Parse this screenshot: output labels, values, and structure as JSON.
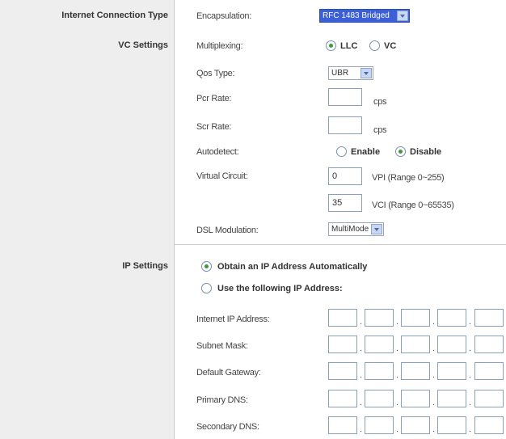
{
  "sections": {
    "internet_connection_type": "Internet Connection Type",
    "vc_settings": "VC Settings",
    "ip_settings": "IP Settings"
  },
  "encapsulation": {
    "label": "Encapsulation:",
    "value": "RFC 1483 Bridged"
  },
  "multiplexing": {
    "label": "Multiplexing:",
    "options": [
      "LLC",
      "VC"
    ],
    "selected": "LLC"
  },
  "qos_type": {
    "label": "Qos Type:",
    "value": "UBR"
  },
  "pcr_rate": {
    "label": "Pcr Rate:",
    "value": "",
    "unit": "cps"
  },
  "scr_rate": {
    "label": "Scr Rate:",
    "value": "",
    "unit": "cps"
  },
  "autodetect": {
    "label": "Autodetect:",
    "options": [
      "Enable",
      "Disable"
    ],
    "selected": "Disable"
  },
  "virtual_circuit": {
    "label": "Virtual Circuit:",
    "vpi_value": "0",
    "vpi_hint": "VPI (Range 0~255)",
    "vci_value": "35",
    "vci_hint": "VCI (Range 0~65535)"
  },
  "dsl_modulation": {
    "label": "DSL Modulation:",
    "value": "MultiMode"
  },
  "ip_mode": {
    "obtain_auto": "Obtain an IP Address Automatically",
    "use_following": "Use the following IP Address:",
    "selected": "obtain_auto"
  },
  "ip_fields": [
    {
      "label": "Internet IP Address:"
    },
    {
      "label": "Subnet Mask:"
    },
    {
      "label": "Default Gateway:"
    },
    {
      "label": "Primary DNS:"
    },
    {
      "label": "Secondary DNS:"
    }
  ],
  "colors": {
    "left_panel": "#eeeeee",
    "select_highlight": "#3b5fd6",
    "radio_checked": "#3c9a3c"
  }
}
